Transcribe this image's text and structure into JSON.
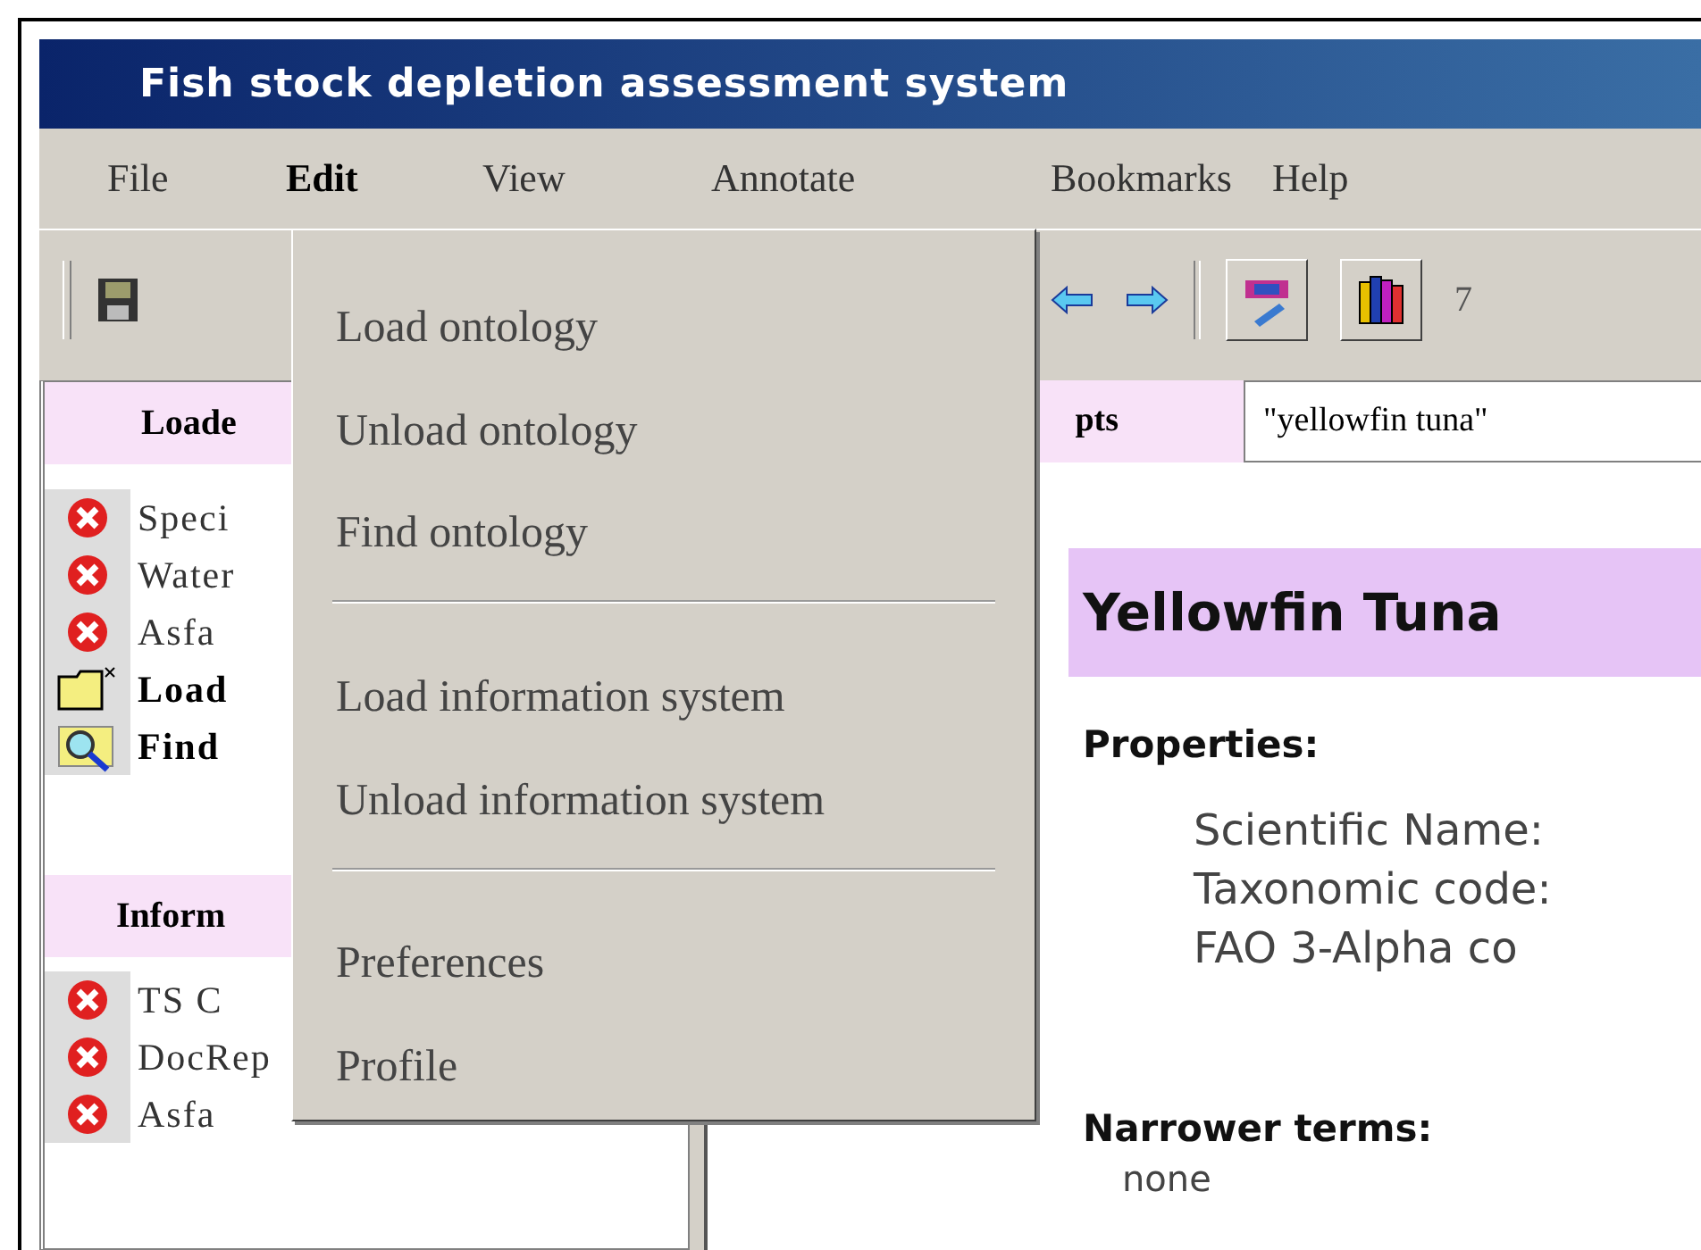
{
  "window": {
    "title": "Fish stock depletion assessment system"
  },
  "menu_bar": [
    {
      "label": "File",
      "open": false
    },
    {
      "label": "Edit",
      "open": true
    },
    {
      "label": "View",
      "open": false
    },
    {
      "label": "Annotate",
      "open": false
    },
    {
      "label": "Bookmarks",
      "open": false
    },
    {
      "label": "Help",
      "open": false
    }
  ],
  "toolbar": {
    "zoom_text": "7"
  },
  "edit_menu": [
    {
      "kind": "item",
      "label": "Load ontology"
    },
    {
      "kind": "item",
      "label": "Unload ontology"
    },
    {
      "kind": "item",
      "label": "Find ontology"
    },
    {
      "kind": "separator"
    },
    {
      "kind": "item",
      "label": "Load information system"
    },
    {
      "kind": "item",
      "label": "Unload information system"
    },
    {
      "kind": "separator"
    },
    {
      "kind": "item",
      "label": "Preferences"
    },
    {
      "kind": "item",
      "label": "Profile"
    }
  ],
  "left_panel": {
    "sections": [
      {
        "title": "Loade",
        "items": [
          {
            "kind": "remove",
            "label": "Speci"
          },
          {
            "kind": "remove",
            "label": "Water"
          },
          {
            "kind": "remove",
            "label": "Asfa"
          },
          {
            "kind": "load",
            "label": "Load"
          },
          {
            "kind": "find",
            "label": "Find"
          }
        ]
      },
      {
        "title": "Inform",
        "items": [
          {
            "kind": "remove",
            "label": "TS C"
          },
          {
            "kind": "remove",
            "label": "DocRep"
          },
          {
            "kind": "remove",
            "label": "Asfa"
          }
        ]
      }
    ]
  },
  "right_panel": {
    "header": "pts",
    "search": {
      "value": "\"yellowfin tuna\""
    },
    "heading": "Yellowfin Tuna",
    "properties_title": "Properties:",
    "properties": [
      "Scientific Name:",
      "Taxonomic code:",
      "FAO 3-Alpha co"
    ],
    "narrower_title": "Narrower terms:",
    "narrower": "none"
  }
}
